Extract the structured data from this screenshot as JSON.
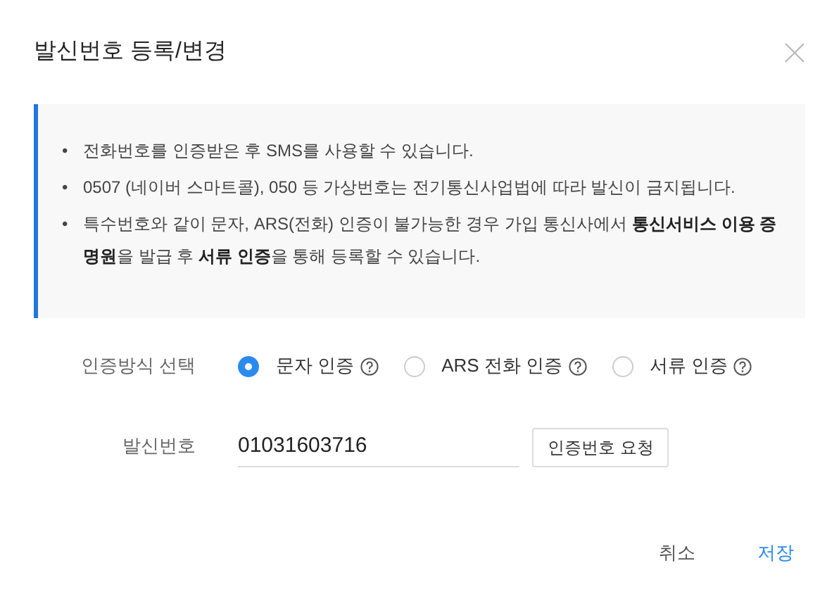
{
  "dialog": {
    "title": "발신번호 등록/변경"
  },
  "notice": {
    "items": [
      {
        "marker": "•",
        "text": "전화번호를 인증받은 후 SMS를 사용할 수 있습니다."
      },
      {
        "marker": "•",
        "text": "0507 (네이버 스마트콜), 050 등 가상번호는 전기통신사업법에 따라 발신이 금지됩니다."
      },
      {
        "marker": "•",
        "text": "특수번호와 같이 문자, ARS(전화) 인증이 불가능한 경우 가입 통신사에서 **통신서비스 이용 증명원**을 발급 후 **서류 인증**을 통해 등록할 수 있습니다."
      }
    ]
  },
  "auth_method": {
    "label": "인증방식 선택",
    "options": [
      {
        "label": "문자 인증",
        "selected": true
      },
      {
        "label": "ARS 전화 인증",
        "selected": false
      },
      {
        "label": "서류 인증",
        "selected": false
      }
    ]
  },
  "sender_number": {
    "label": "발신번호",
    "value": "01031603716",
    "request_button": "인증번호 요청"
  },
  "buttons": [
    {
      "label": "취소",
      "kind": "cancel"
    },
    {
      "label": "저장",
      "kind": "primary"
    }
  ]
}
